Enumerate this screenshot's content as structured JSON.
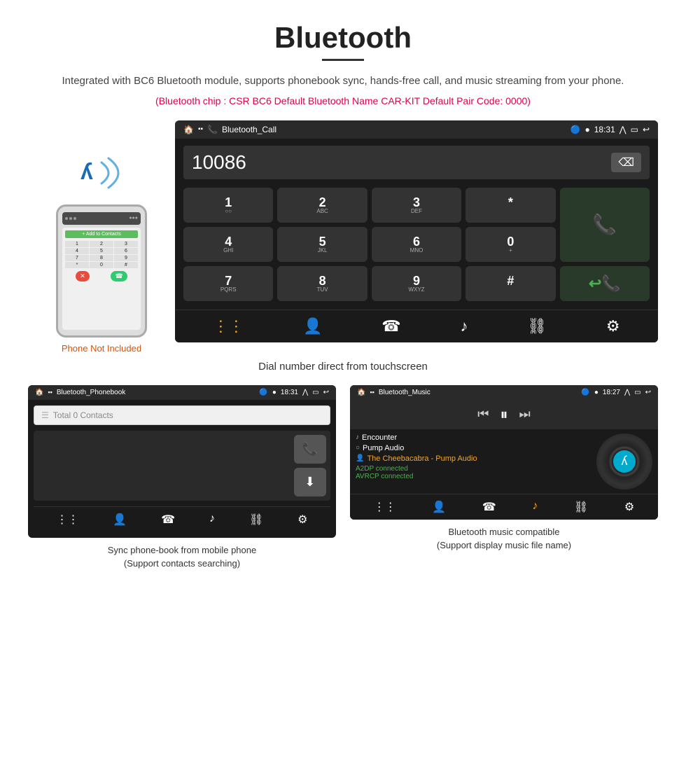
{
  "page": {
    "title": "Bluetooth",
    "subtitle": "Integrated with BC6 Bluetooth module, supports phonebook sync, hands-free call, and music streaming from your phone.",
    "spec_line": "(Bluetooth chip : CSR BC6    Default Bluetooth Name CAR-KIT    Default Pair Code: 0000)",
    "phone_not_included": "Phone Not Included",
    "dial_caption": "Dial number direct from touchscreen"
  },
  "dial_screen": {
    "app_name": "Bluetooth_Call",
    "time": "18:31",
    "number": "10086",
    "keys": [
      {
        "main": "1",
        "sub": "○○"
      },
      {
        "main": "2",
        "sub": "ABC"
      },
      {
        "main": "3",
        "sub": "DEF"
      },
      {
        "main": "*",
        "sub": ""
      },
      {
        "main": "☎",
        "sub": ""
      },
      {
        "main": "4",
        "sub": "GHI"
      },
      {
        "main": "5",
        "sub": "JKL"
      },
      {
        "main": "6",
        "sub": "MNO"
      },
      {
        "main": "0",
        "sub": "+"
      },
      {
        "main": "☎↩",
        "sub": ""
      },
      {
        "main": "7",
        "sub": "PQRS"
      },
      {
        "main": "8",
        "sub": "TUV"
      },
      {
        "main": "9",
        "sub": "WXYZ"
      },
      {
        "main": "#",
        "sub": ""
      }
    ],
    "nav_icons": [
      "⋮⋮⋮",
      "👤",
      "☎~",
      "♪",
      "⛓",
      "⚙"
    ]
  },
  "phonebook_screen": {
    "app_name": "Bluetooth_Phonebook",
    "time": "18:31",
    "search_placeholder": "Total 0 Contacts",
    "caption_line1": "Sync phone-book from mobile phone",
    "caption_line2": "(Support contacts searching)"
  },
  "music_screen": {
    "app_name": "Bluetooth_Music",
    "time": "18:27",
    "track1_icon": "♪",
    "track1": "Encounter",
    "track2_icon": "○",
    "track2": "Pump Audio",
    "track3_icon": "👤",
    "track3": "The Cheebacabra - Pump Audio",
    "status1": "A2DP connected",
    "status2": "AVRCP connected",
    "caption_line1": "Bluetooth music compatible",
    "caption_line2": "(Support display music file name)"
  }
}
